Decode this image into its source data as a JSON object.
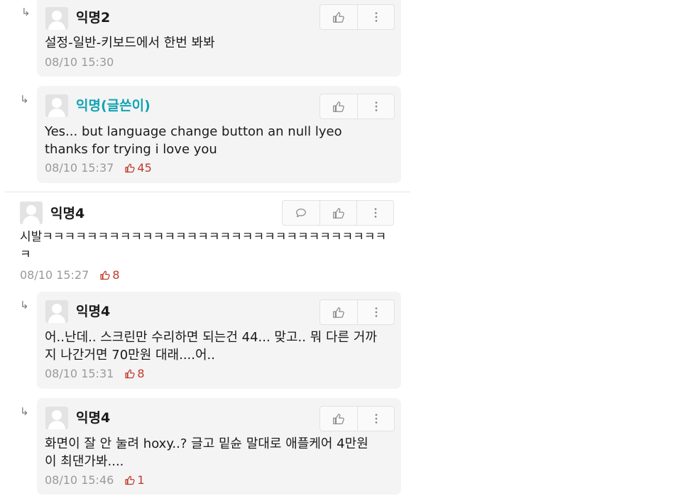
{
  "comments": [
    {
      "author": "익명2",
      "content_lines": [
        "설정-일반-키보드에서 한번 봐봐"
      ],
      "time": "08/10 15:30",
      "likes": ""
    },
    {
      "author": "익명(글쓴이)",
      "content_lines": [
        "Yes... but language change button an null lyeo",
        "thanks for trying i love you"
      ],
      "time": "08/10 15:37",
      "likes": "45"
    },
    {
      "author": "익명4",
      "content_lines": [
        "시발ㅋㅋㅋㅋㅋㅋㅋㅋㅋㅋㅋㅋㅋㅋㅋㅋㅋㅋㅋㅋㅋㅋㅋㅋㅋㅋㅋㅋㅋㅋㅋ",
        "ㅋ"
      ],
      "time": "08/10 15:27",
      "likes": "8"
    },
    {
      "author": "익명4",
      "content_lines": [
        "어..난데.. 스크린만 수리하면 되는건 44... 맞고.. 뭐 다른 거까",
        "지 나간거면 70만원 대래....어.."
      ],
      "time": "08/10 15:31",
      "likes": "8"
    },
    {
      "author": "익명4",
      "content_lines": [
        "화면이 잘 안 눌려 hoxy..? 글고 밑슌 말대로 애플케어 4만원",
        "이 최댄가봐...."
      ],
      "time": "08/10 15:46",
      "likes": "1"
    }
  ],
  "icons": {
    "reply_arrow": "reply-arrow-icon",
    "like": "thumbs-up-icon",
    "more": "more-vertical-icon",
    "comment": "comment-icon",
    "avatar": "default-avatar"
  },
  "colors": {
    "op_author": "#13a4b4",
    "like_count": "#c0392b",
    "bubble_bg": "#f4f4f4",
    "meta_text": "#9a9a9a"
  }
}
